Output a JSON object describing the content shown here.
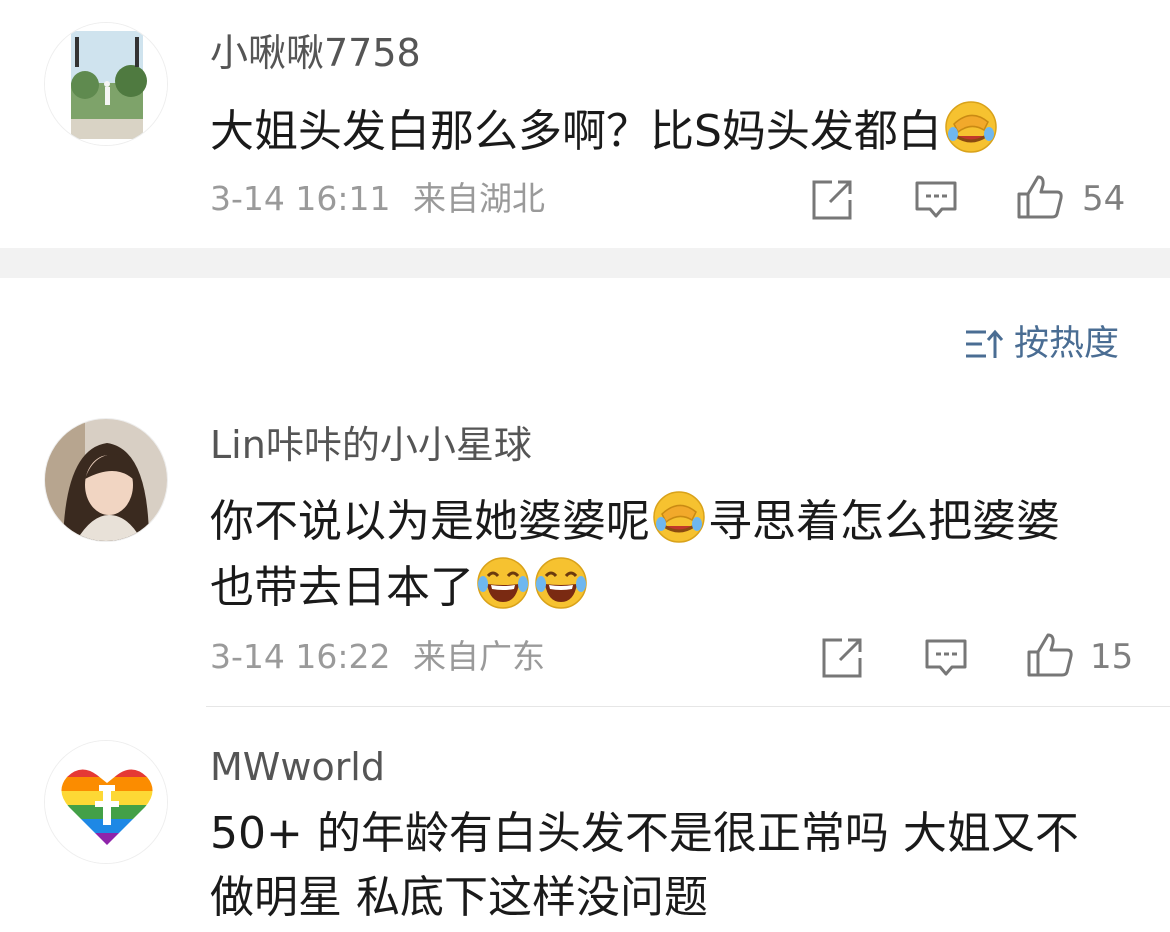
{
  "comments": [
    {
      "username": "小啾啾7758",
      "text_line1": "大姐头发白那么多啊？比S妈头发都白",
      "time": "3-14 16:11",
      "location": "来自湖北",
      "likes": "54",
      "avatar_icon": "landscape-photo-avatar"
    },
    {
      "username": "Lin咔咔的小小星球",
      "text_line1a": "你不说以为是她婆婆呢",
      "text_line1b": "寻思着怎么把婆婆",
      "text_line2": "也带去日本了",
      "time": "3-14 16:22",
      "location": "来自广东",
      "likes": "15",
      "avatar_icon": "woman-portrait-avatar"
    },
    {
      "username": "MWworld",
      "text_line1": "50+ 的年龄有白头发不是很正常吗 大姐又不",
      "text_line2": "做明星 私底下这样没问题",
      "avatar_icon": "rainbow-heart-avatar"
    }
  ],
  "sort": {
    "label": "按热度",
    "icon": "sort-order-icon"
  },
  "colors": {
    "link_blue": "#4a6d93",
    "meta_gray": "#9a9a9a",
    "separator": "#f2f2f2"
  }
}
